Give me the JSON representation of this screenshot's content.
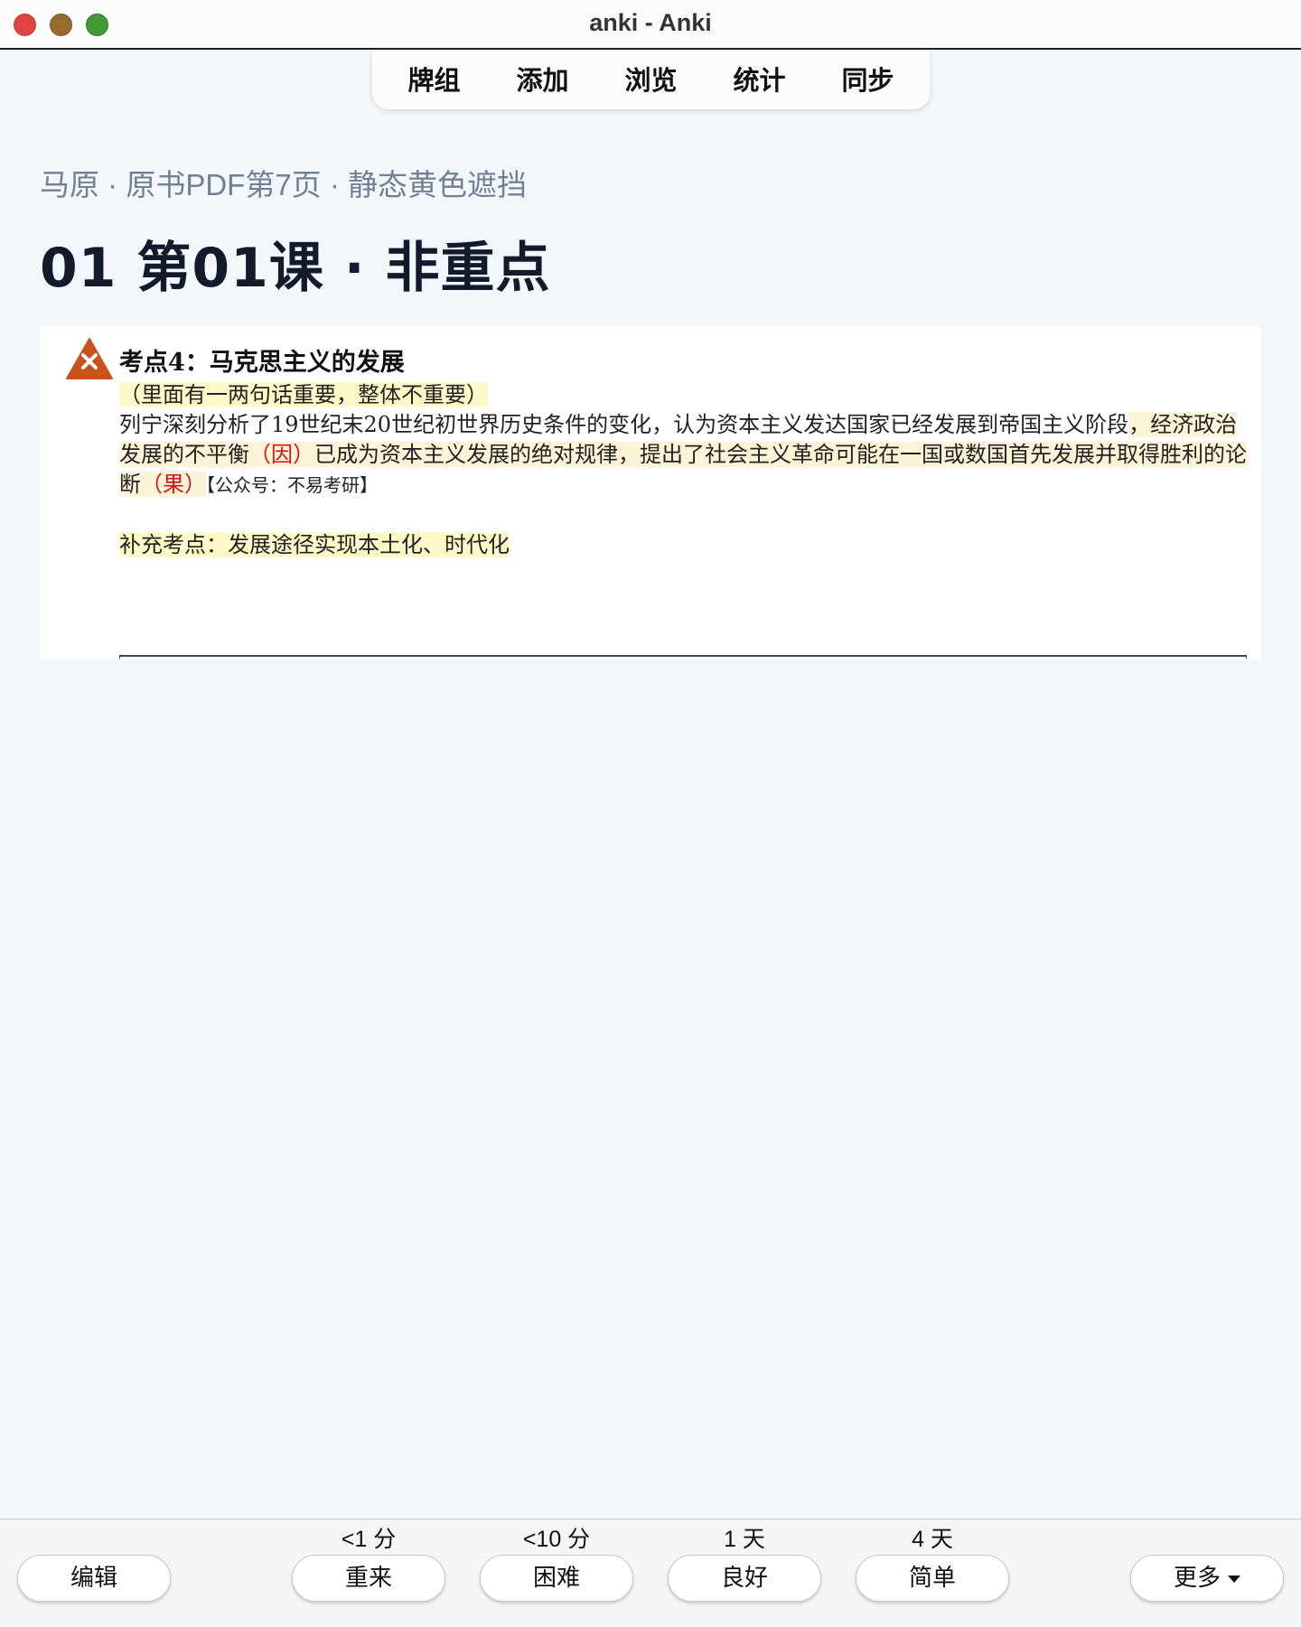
{
  "window": {
    "title": "anki - Anki"
  },
  "nav": {
    "items": [
      {
        "label": "牌组"
      },
      {
        "label": "添加"
      },
      {
        "label": "浏览"
      },
      {
        "label": "统计"
      },
      {
        "label": "同步"
      }
    ]
  },
  "header": {
    "subtitle": "马原 · 原书PDF第7页 · 静态黄色遮挡",
    "title": "01 第01课 · 非重点"
  },
  "card": {
    "warning_icon": "warning-triangle-x-icon",
    "heading": "考点4：马克思主义的发展",
    "note": "（里面有一两句话重要，整体不重要）",
    "para_part1": "列宁深刻分析了19世纪末20世纪初世界历史条件的变化，认为资本主义发达国家已经发展到帝国主义阶段",
    "para_part2": "，经济政治发展的不平衡",
    "cause": "（因）",
    "para_part3": "已成为资本主义发展的绝对规律，提出了社会主义革命可能在一国或数国首先发展并取得胜利的论断",
    "effect": "（果）",
    "source": "【公众号：不易考研】",
    "supplement": "补充考点：发展途径实现本土化、时代化"
  },
  "footer": {
    "edit_label": "编辑",
    "more_label": "更多",
    "answers": [
      {
        "interval": "<1 分",
        "label": "重来"
      },
      {
        "interval": "<10 分",
        "label": "困难"
      },
      {
        "interval": "1 天",
        "label": "良好"
      },
      {
        "interval": "4 天",
        "label": "简单"
      }
    ]
  },
  "colors": {
    "accent_warning": "#c9531a",
    "highlight_yellow": "#fff9c9",
    "highlight_peach": "#fdf3d6",
    "emphasis_red": "#d3131a"
  }
}
